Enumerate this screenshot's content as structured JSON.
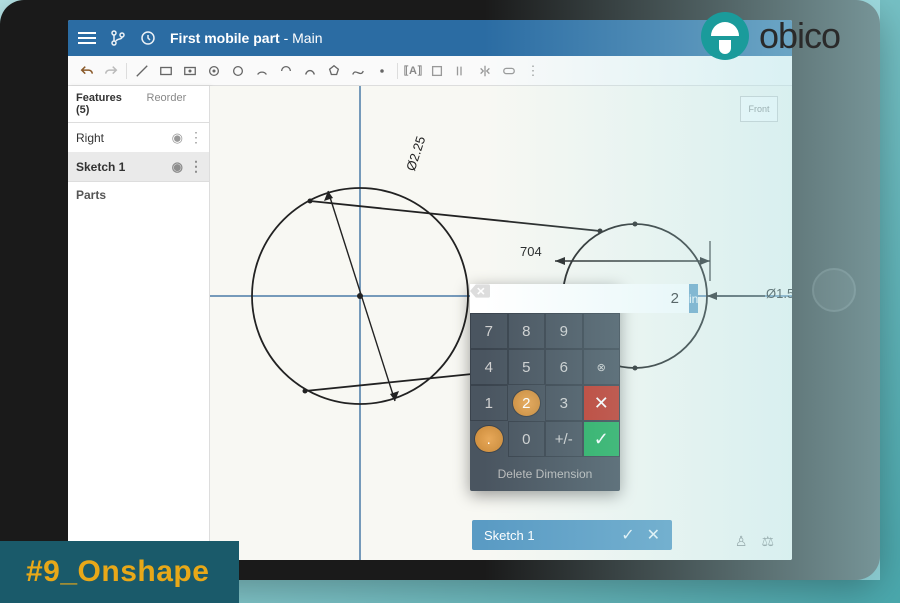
{
  "brand": {
    "name": "obico"
  },
  "hashtag": "#9_Onshape",
  "header": {
    "doc_name": "First mobile part",
    "doc_workspace": "Main"
  },
  "sidebar": {
    "features_tab": "Features (5)",
    "reorder_tab": "Reorder",
    "items": [
      {
        "label": "Right"
      },
      {
        "label": "Sketch 1"
      }
    ],
    "parts_label": "Parts"
  },
  "canvas": {
    "dim_diameter_left": "Ø2.25",
    "dim_horizontal": "704",
    "dim_diameter_right": "Ø1.5",
    "view_cube": "Front"
  },
  "dimension_input": {
    "value": "2",
    "unit": "in",
    "keys": {
      "k7": "7",
      "k8": "8",
      "k9": "9",
      "k4": "4",
      "k5": "5",
      "k6": "6",
      "k1": "1",
      "k2": "2",
      "k3": "3",
      "kdot": ".",
      "k0": "0",
      "kpm": "+/-"
    },
    "delete_label": "Delete Dimension"
  },
  "bottom_bar": {
    "label": "Sketch 1"
  }
}
